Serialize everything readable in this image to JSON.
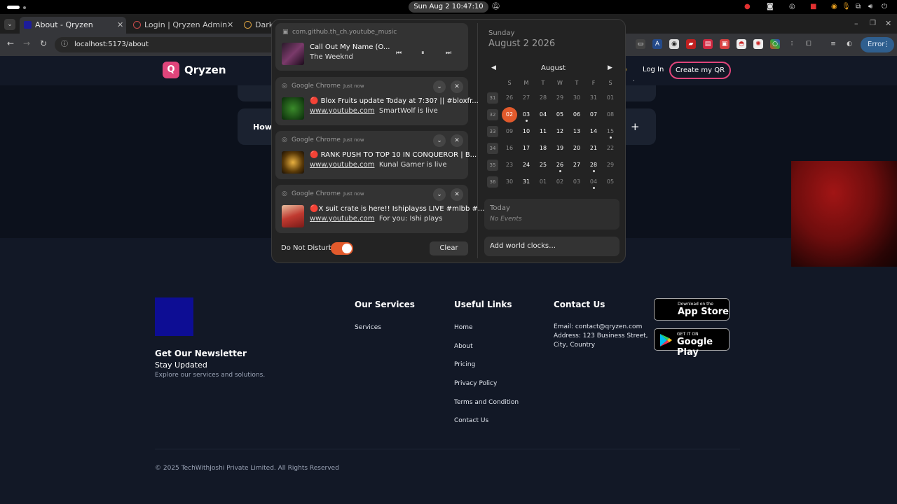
{
  "system": {
    "clock": "Sun Aug 2  10:47:10 AM"
  },
  "browser": {
    "tabs": [
      {
        "title": "About - Qryzen",
        "active": true
      },
      {
        "title": "Login | Qryzen Admin",
        "active": false
      },
      {
        "title": "Dark",
        "active": false
      }
    ],
    "url": "localhost:5173/about",
    "error_label": "Error"
  },
  "site": {
    "logo_letter": "Q",
    "brand": "Qryzen",
    "login": "Log In",
    "create": "Create my QR",
    "faq_partial": "How",
    "faq_plus": "+"
  },
  "media": {
    "app": "com.github.th_ch.youtube_music",
    "title": "Call Out My Name (O...",
    "artist": "The Weeknd"
  },
  "notifications": [
    {
      "app": "Google Chrome",
      "time": "Just now",
      "title": "🔴 Blox Fruits update Today at 7:30? || #bloxfr...",
      "site": "www.youtube.com",
      "text": "SmartWolf is live",
      "thumb_color": "#1f4a1a"
    },
    {
      "app": "Google Chrome",
      "time": "Just now",
      "title": "🔴 RANK PUSH TO TOP 10 IN CONQUEROR | B...",
      "site": "www.youtube.com",
      "text": "Kunal Gamer is live",
      "thumb_color": "#6e4a10"
    },
    {
      "app": "Google Chrome",
      "time": "Just now",
      "title": "🔴X suit crate is here!! Ishiplayss LIVE #mlbb #...",
      "site": "www.youtube.com",
      "text": "For you: Ishi plays",
      "thumb_color": "#b8483a"
    }
  ],
  "dnd_label": "Do Not Disturb",
  "clear_label": "Clear",
  "calendar": {
    "weekday": "Sunday",
    "date": "August 2 2026",
    "month": "August",
    "day_headers": [
      "S",
      "M",
      "T",
      "W",
      "T",
      "F",
      "S"
    ],
    "weeks": [
      {
        "num": "31",
        "days": [
          "26",
          "27",
          "28",
          "29",
          "30",
          "31",
          "01"
        ]
      },
      {
        "num": "32",
        "days": [
          "02",
          "03",
          "04",
          "05",
          "06",
          "07",
          "08"
        ]
      },
      {
        "num": "33",
        "days": [
          "09",
          "10",
          "11",
          "12",
          "13",
          "14",
          "15"
        ]
      },
      {
        "num": "34",
        "days": [
          "16",
          "17",
          "18",
          "19",
          "20",
          "21",
          "22"
        ]
      },
      {
        "num": "35",
        "days": [
          "23",
          "24",
          "25",
          "26",
          "27",
          "28",
          "29"
        ]
      },
      {
        "num": "36",
        "days": [
          "30",
          "31",
          "01",
          "02",
          "03",
          "04",
          "05"
        ]
      }
    ],
    "today_label": "Today",
    "no_events": "No Events",
    "world_clocks": "Add world clocks…"
  },
  "footer": {
    "newsletter_heading": "Get Our Newsletter",
    "newsletter_sub": "Stay Updated",
    "newsletter_desc": "Explore our services and solutions.",
    "services_heading": "Our Services",
    "services": [
      "Services"
    ],
    "links_heading": "Useful Links",
    "links": [
      "Home",
      "About",
      "Pricing",
      "Privacy Policy",
      "Terms and Condition",
      "Contact Us"
    ],
    "contact_heading": "Contact Us",
    "email": "Email: contact@qryzen.com",
    "address": "Address: 123 Business Street, City, Country",
    "appstore_small": "Download on the",
    "appstore_big": "App Store",
    "play_small": "GET IT ON",
    "play_big": "Google Play",
    "copyright": "© 2025 TechWithJoshi Private Limited. All Rights Reserved"
  },
  "colors": {
    "accent": "#e0457b",
    "gnome_accent": "#e25a2c",
    "page_bg": "#121826"
  }
}
